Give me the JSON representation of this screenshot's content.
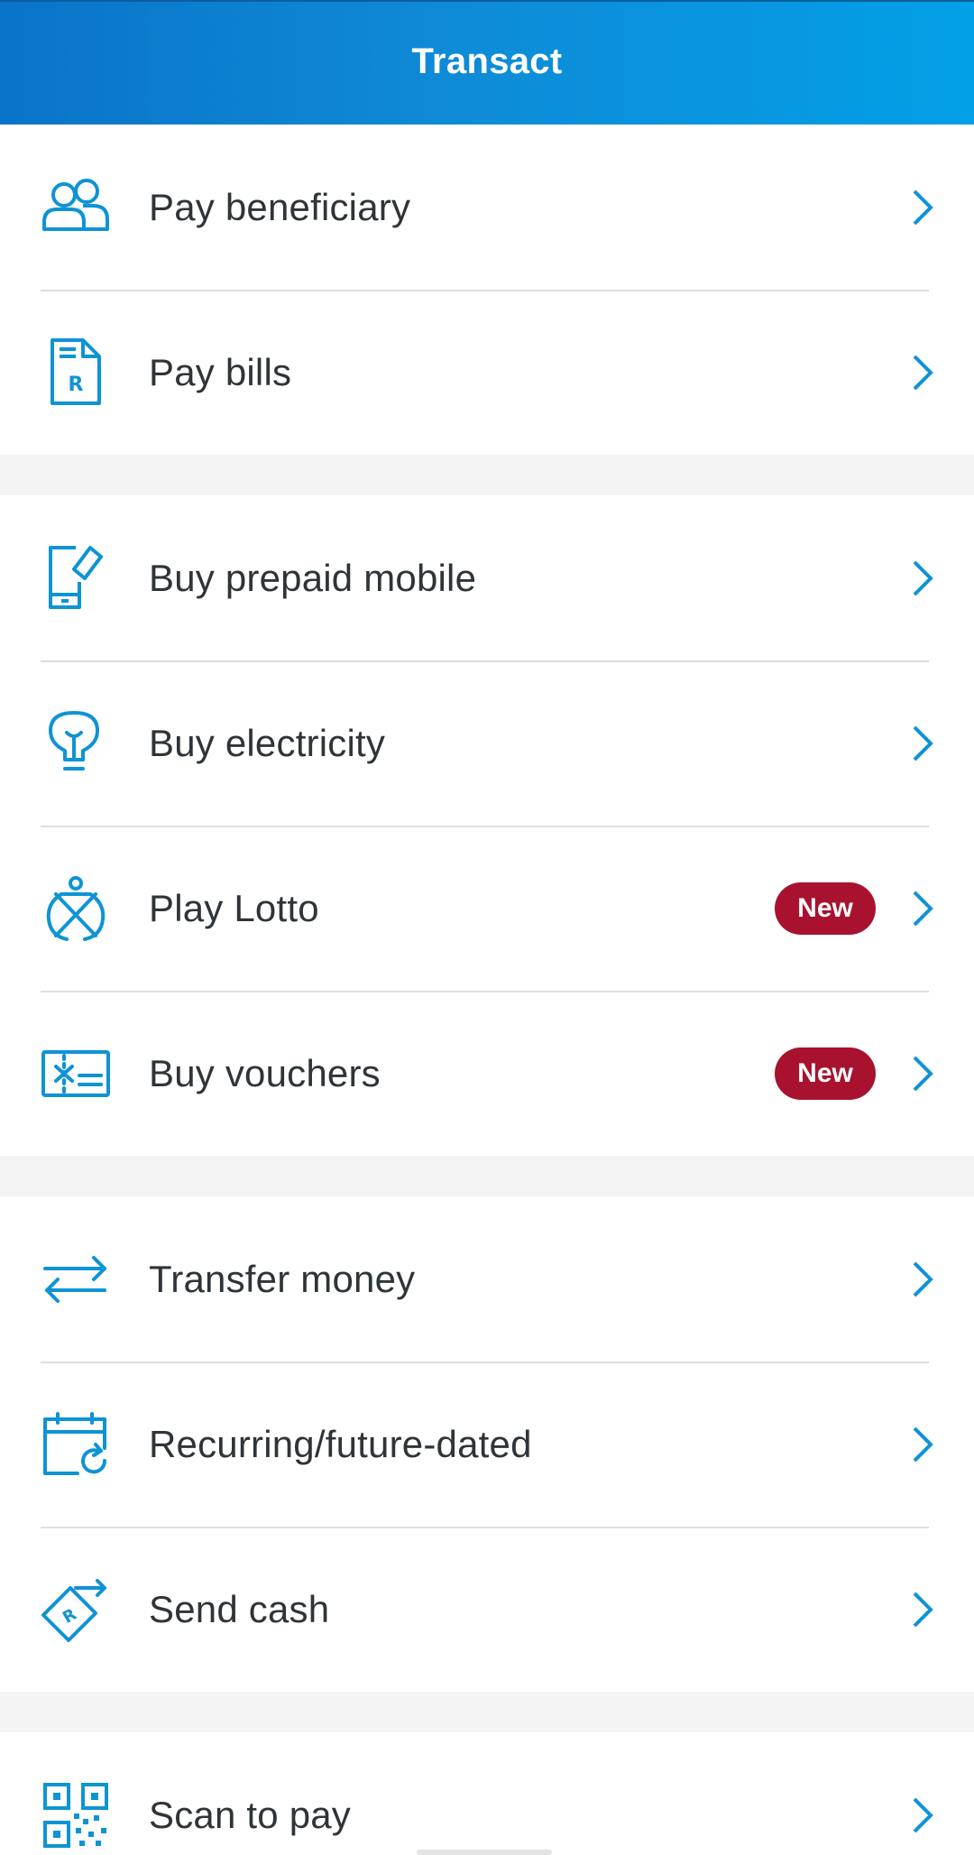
{
  "header": {
    "title": "Transact"
  },
  "colors": {
    "accent": "#0e93d5",
    "badge": "#a8122e",
    "header_start": "#0a74c8",
    "header_end": "#02a0e6"
  },
  "groups": [
    {
      "items": [
        {
          "label": "Pay beneficiary",
          "icon": "users-icon"
        },
        {
          "label": "Pay bills",
          "icon": "bill-icon"
        }
      ]
    },
    {
      "items": [
        {
          "label": "Buy prepaid mobile",
          "icon": "mobile-icon"
        },
        {
          "label": "Buy electricity",
          "icon": "lightbulb-icon"
        },
        {
          "label": "Play Lotto",
          "icon": "lotto-icon",
          "badge": "New"
        },
        {
          "label": "Buy vouchers",
          "icon": "voucher-icon",
          "badge": "New"
        }
      ]
    },
    {
      "items": [
        {
          "label": "Transfer money",
          "icon": "transfer-icon"
        },
        {
          "label": "Recurring/future-dated",
          "icon": "calendar-icon"
        },
        {
          "label": "Send cash",
          "icon": "send-cash-icon"
        }
      ]
    },
    {
      "items": [
        {
          "label": "Scan to pay",
          "icon": "qr-code-icon"
        }
      ]
    }
  ]
}
